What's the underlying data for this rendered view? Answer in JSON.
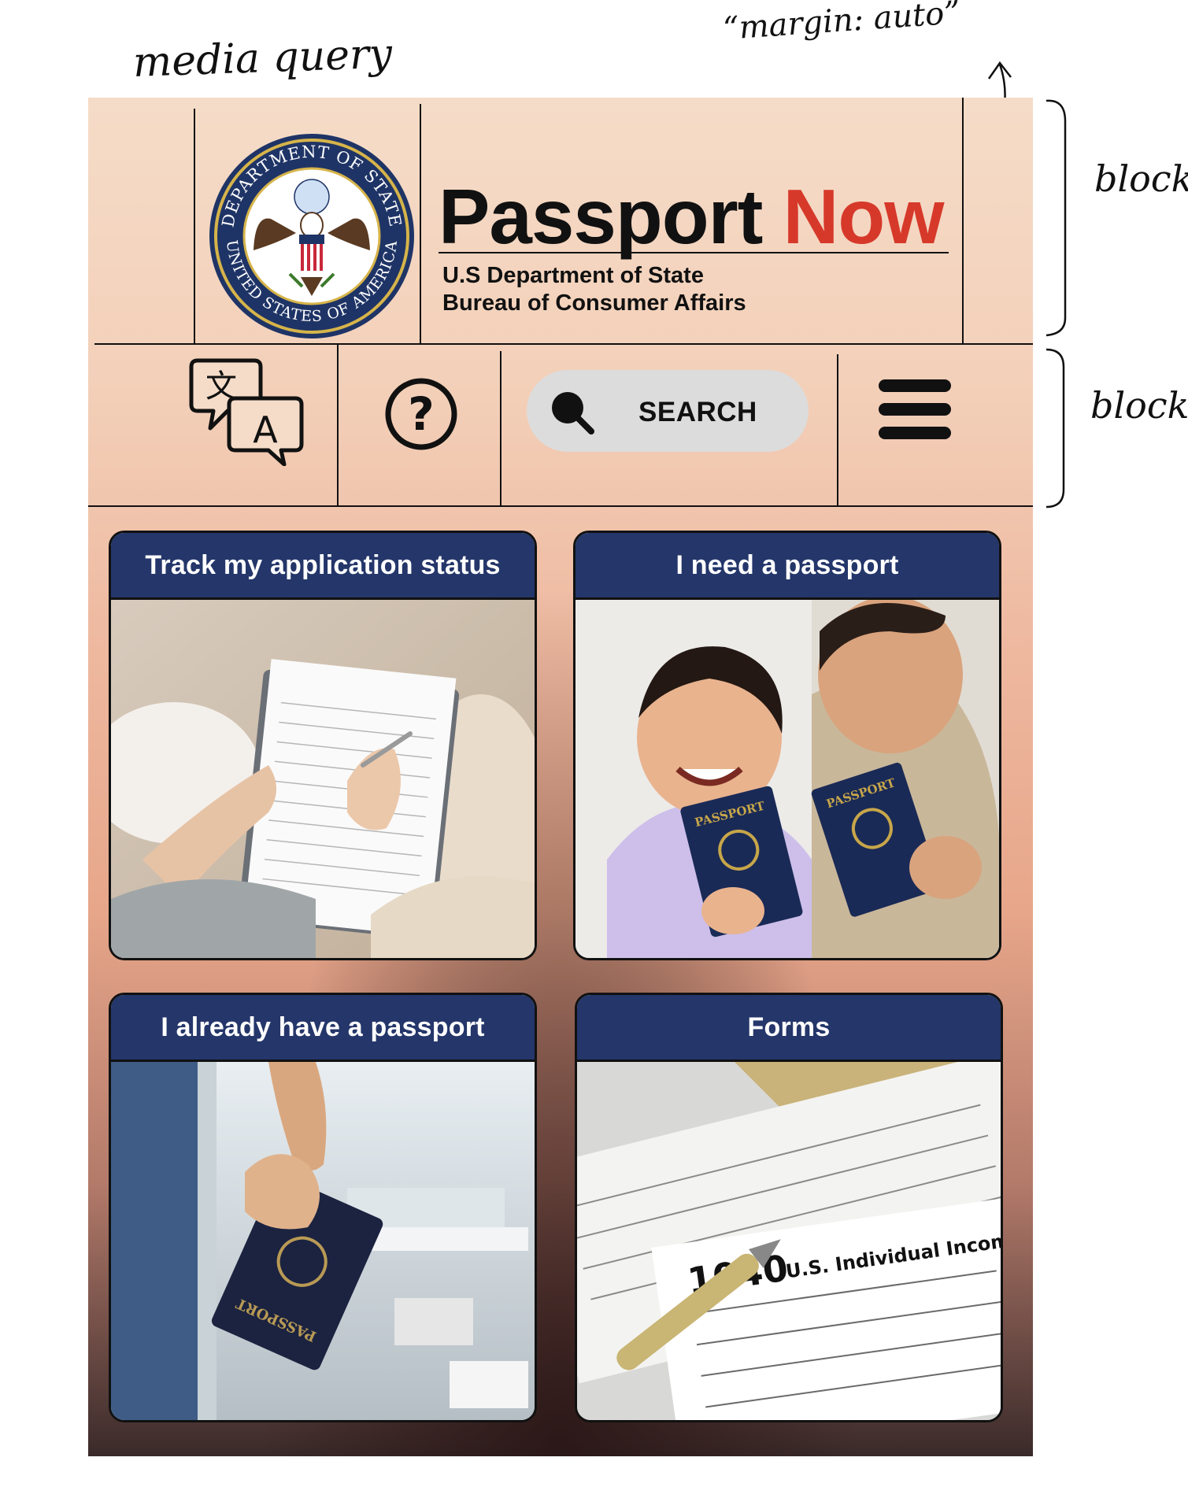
{
  "annotations": {
    "media_query": "media query",
    "margin_auto": "“margin: auto”",
    "block_top": "block",
    "block_nav": "block"
  },
  "header": {
    "title_main": "Passport",
    "title_accent": "Now",
    "subtitle_line1": "U.S Department of State",
    "subtitle_line2": "Bureau of Consumer Affairs",
    "seal": {
      "top_text": "DEPARTMENT OF STATE",
      "bottom_text": "UNITED STATES OF AMERICA"
    }
  },
  "nav": {
    "translate_icon": "translate-icon",
    "translate_glyphs": [
      "文",
      "A"
    ],
    "help_icon": "help-icon",
    "help_glyph": "?",
    "search_icon": "search-icon",
    "search_label": "SEARCH",
    "menu_icon": "hamburger-menu-icon"
  },
  "cards": [
    {
      "title": "Track my application status",
      "image": "clipboard-form-photo"
    },
    {
      "title": "I need a passport",
      "image": "family-with-passports-photo",
      "passport_label": "PASSPORT"
    },
    {
      "title": "I already have a passport",
      "image": "passport-at-airport-photo",
      "passport_label": "PASSPORT"
    },
    {
      "title": "Forms",
      "image": "tax-form-1040-photo",
      "form_number": "1040",
      "form_title": "U.S. Individual Income"
    }
  ],
  "colors": {
    "accent_red": "#d6392a",
    "card_header_navy": "#24366a",
    "search_pill": "#dcdcdc",
    "header_bg": "#f5dcc8"
  }
}
